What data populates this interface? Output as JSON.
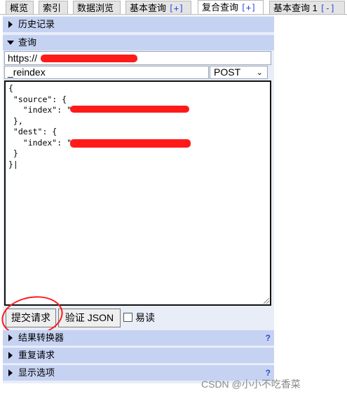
{
  "tabs": [
    {
      "label": "概览"
    },
    {
      "label": "索引"
    },
    {
      "label": "数据浏览"
    },
    {
      "label": "基本查询",
      "suffix": "[+]"
    },
    {
      "label": "复合查询",
      "suffix": "[+]",
      "active": true
    },
    {
      "label": "基本查询 1",
      "suffix": "[-]"
    }
  ],
  "sections": {
    "history": "历史记录",
    "query": "查询",
    "transformer": "结果转换器",
    "repeat": "重复请求",
    "display": "显示选项",
    "help_mark": "?"
  },
  "request": {
    "url_value": "https://",
    "path_value": "_reindex",
    "method": "POST",
    "method_chevron": "⌄",
    "body_lines": [
      "{",
      " \"source\": {",
      "   \"index\": \"",
      " },",
      " \"dest\": {",
      "   \"index\": \"",
      " }",
      "}|"
    ]
  },
  "actions": {
    "submit": "提交请求",
    "validate": "验证 JSON",
    "readonly": "易读"
  },
  "watermark": "CSDN @小小不吃香菜",
  "colors": {
    "header_bg": "#c6d2f2",
    "panel_bg": "#e8edf8",
    "annotation_red": "#ff1a1a",
    "link_blue": "#2a4bd7"
  }
}
